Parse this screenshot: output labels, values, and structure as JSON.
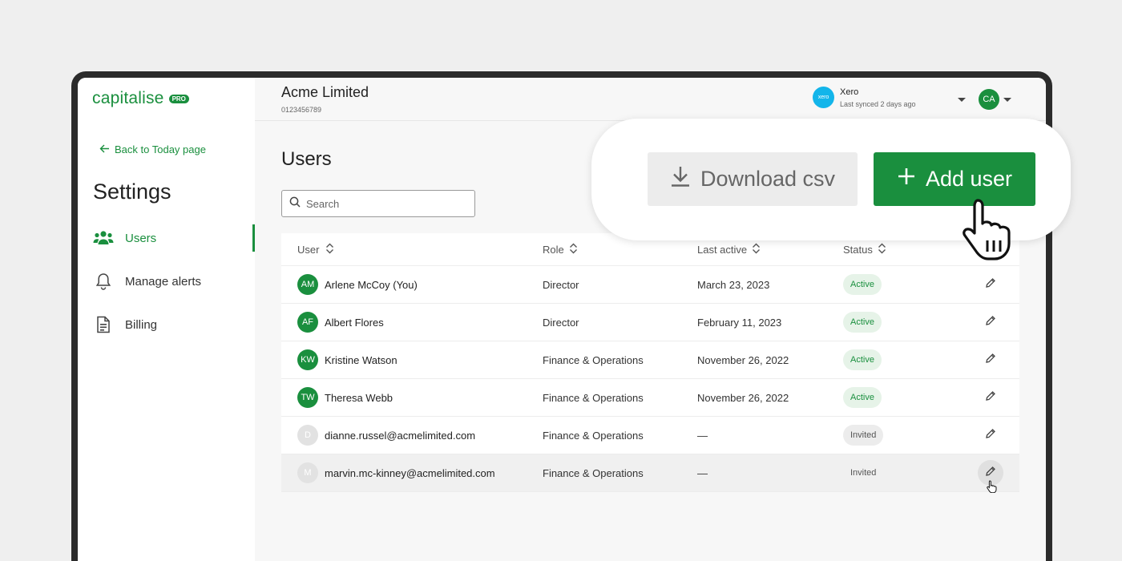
{
  "brand": {
    "name": "capitalise",
    "badge": "PRO"
  },
  "sidebar": {
    "back_link": "Back to Today page",
    "title": "Settings",
    "items": [
      {
        "label": "Users",
        "icon": "users-icon",
        "active": true
      },
      {
        "label": "Manage alerts",
        "icon": "bell-icon",
        "active": false
      },
      {
        "label": "Billing",
        "icon": "document-icon",
        "active": false
      }
    ]
  },
  "header": {
    "company_name": "Acme Limited",
    "company_id": "0123456789",
    "integration": {
      "logo_text": "xero",
      "name": "Xero",
      "sync_status": "Last synced 2 days ago"
    },
    "user_initials": "CA"
  },
  "page": {
    "title": "Users",
    "search_placeholder": "Search"
  },
  "table": {
    "columns": [
      "User",
      "Role",
      "Last active",
      "Status"
    ],
    "rows": [
      {
        "initials": "AM",
        "name": "Arlene McCoy (You)",
        "role": "Director",
        "last_active": "March 23, 2023",
        "status": "Active"
      },
      {
        "initials": "AF",
        "name": "Albert Flores",
        "role": "Director",
        "last_active": "February 11, 2023",
        "status": "Active"
      },
      {
        "initials": "KW",
        "name": "Kristine Watson",
        "role": "Finance & Operations",
        "last_active": "November 26, 2022",
        "status": "Active"
      },
      {
        "initials": "TW",
        "name": "Theresa Webb",
        "role": "Finance & Operations",
        "last_active": "November 26, 2022",
        "status": "Active"
      },
      {
        "initials": "D",
        "name": "dianne.russel@acmelimited.com",
        "role": "Finance & Operations",
        "last_active": "—",
        "status": "Invited"
      },
      {
        "initials": "M",
        "name": "marvin.mc-kinney@acmelimited.com",
        "role": "Finance & Operations",
        "last_active": "—",
        "status": "Invited"
      }
    ]
  },
  "actions": {
    "download_label": "Download csv",
    "add_label": "Add user"
  },
  "colors": {
    "brand_green": "#1a8f3e",
    "active_badge_bg": "#e6f3e8",
    "xero_blue": "#13b5ea"
  }
}
